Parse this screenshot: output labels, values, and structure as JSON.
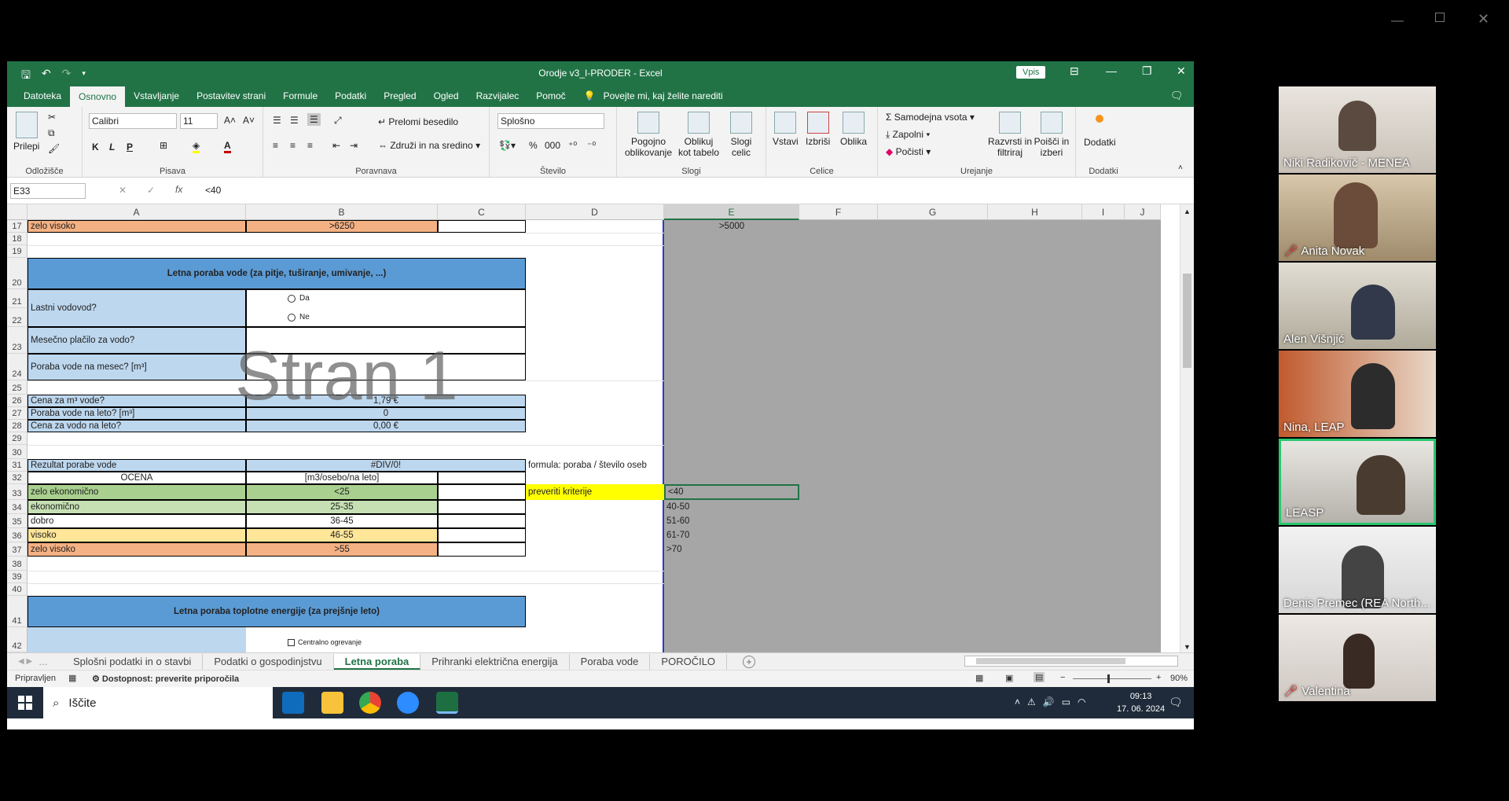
{
  "window": {
    "title": "Orodje v3_I-PRODER  -  Excel",
    "signin": "Vpis"
  },
  "menu": {
    "items": [
      "Datoteka",
      "Osnovno",
      "Vstavljanje",
      "Postavitev strani",
      "Formule",
      "Podatki",
      "Pregled",
      "Ogled",
      "Razvijalec",
      "Pomoč"
    ],
    "active": "Osnovno",
    "tell": "Povejte mi, kaj želite narediti"
  },
  "ribbon": {
    "groups": {
      "clipboard": "Odložišče",
      "font": "Pisava",
      "align": "Poravnava",
      "number": "Število",
      "styles": "Slogi",
      "cells": "Celice",
      "edit": "Urejanje",
      "addins": "Dodatki"
    },
    "paste": "Prilepi",
    "font_name": "Calibri",
    "font_size": "11",
    "bold": "K",
    "italic": "L",
    "underline": "P",
    "wrap": "Prelomi besedilo",
    "merge": "Združi in na sredino",
    "number_format": "Splošno",
    "cond": "Pogojno oblikovanje",
    "format_table": "Oblikuj kot tabelo",
    "cell_styles": "Slogi celic",
    "insert": "Vstavi",
    "delete": "Izbriši",
    "format": "Oblika",
    "autosum": "Samodejna vsota",
    "fill": "Zapolni",
    "clear": "Počisti",
    "sort": "Razvrsti in filtriraj",
    "find": "Poišči in izberi",
    "addins": "Dodatki"
  },
  "formula": {
    "namebox": "E33",
    "fx": "fx",
    "value": "<40"
  },
  "columns": [
    "A",
    "B",
    "C",
    "D",
    "E",
    "F",
    "G",
    "H",
    "I",
    "J"
  ],
  "rows": [
    "17",
    "18",
    "19",
    "20",
    "21",
    "22",
    "23",
    "24",
    "25",
    "26",
    "27",
    "28",
    "29",
    "30",
    "31",
    "32",
    "33",
    "34",
    "35",
    "36",
    "37",
    "38",
    "39",
    "40",
    "41",
    "42"
  ],
  "cells": {
    "a17": "zelo visoko",
    "b17": ">6250",
    "e17": ">5000",
    "a20": "Letna poraba vode (za pitje, tuširanje, umivanje, ...)",
    "a21": "Lastni vodovod?",
    "opt_da": "Da",
    "opt_ne": "Ne",
    "a23": "Mesečno plačilo za vodo?",
    "a24": "Poraba vode na mesec? [m³]",
    "watermark": "Stran 1",
    "a26": "Cena za m³ vode?",
    "b26": "1,79 €",
    "a27": "Poraba vode na leto? [m³]",
    "b27": "0",
    "a28": "Cena za vodo na leto?",
    "b28": "0,00 €",
    "a31": "Rezultat porabe vode",
    "b31": "#DIV/0!",
    "d31": "formula: poraba / število oseb",
    "a32": "OCENA",
    "b32": "[m3/osebo/na leto]",
    "a33": "zelo ekonomično",
    "b33": "<25",
    "d33": "preveriti kriterije",
    "e33": "<40",
    "a34": "ekonomično",
    "b34": "25-35",
    "e34": "40-50",
    "a35": "dobro",
    "b35": "36-45",
    "e35": "51-60",
    "a36": "visoko",
    "b36": "46-55",
    "e36": "61-70",
    "a37": "zelo visoko",
    "b37": ">55",
    "e37": ">70",
    "a41": "Letna poraba toplotne energije (za prejšnje leto)",
    "a42": "Centralno ogrevanje"
  },
  "tabs": [
    "Splošni podatki in o stavbi",
    "Podatki o gospodinjstvu",
    "Letna poraba",
    "Prihranki električna energija",
    "Poraba vode",
    "POROČILO"
  ],
  "active_tab": "Letna poraba",
  "status": {
    "ready": "Pripravljen",
    "access": "Dostopnost: preverite priporočila",
    "zoom": "90%"
  },
  "taskbar": {
    "search": "Iščite",
    "time": "09:13",
    "date": "17. 06. 2024"
  },
  "participants": [
    {
      "name": "Niki Radikovič - MENEA",
      "muted": false,
      "active": false
    },
    {
      "name": "Anita Novak",
      "muted": true,
      "active": false
    },
    {
      "name": "Alen Višnjić",
      "muted": false,
      "active": false
    },
    {
      "name": "Nina, LEAP",
      "muted": false,
      "active": false
    },
    {
      "name": "LEASP",
      "muted": false,
      "active": true
    },
    {
      "name": "Denis Premec (REA North...",
      "muted": false,
      "active": false
    },
    {
      "name": "Valentina",
      "muted": true,
      "active": false
    }
  ]
}
